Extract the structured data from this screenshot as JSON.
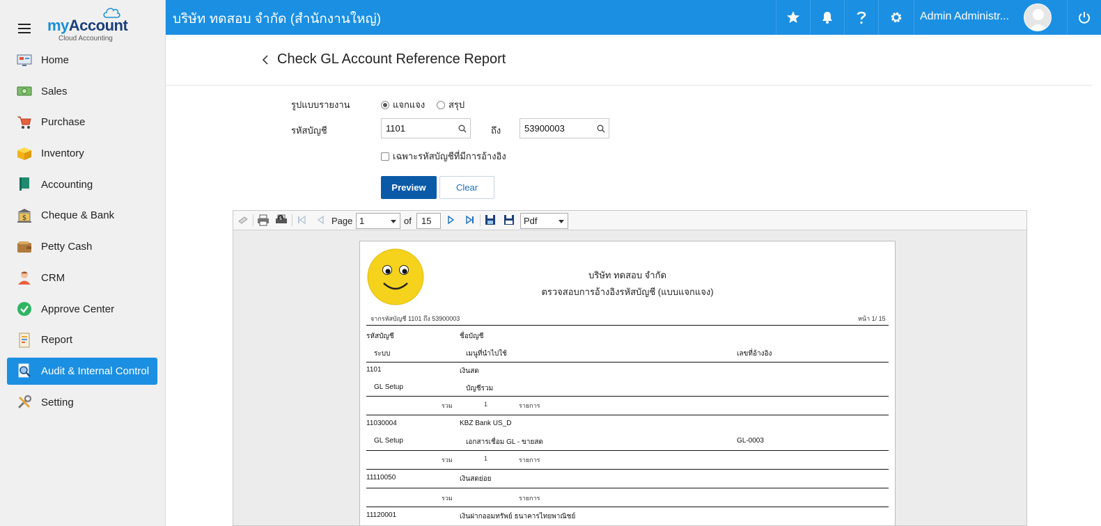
{
  "app": {
    "logo_word_my": "my",
    "logo_word_account": "Account",
    "logo_subtitle": "Cloud Accounting",
    "company": "บริษัท ทดสอบ จำกัด (สำนักงานใหญ่)",
    "user_name": "Admin Administr...",
    "brand_color": "#1b8fe2"
  },
  "sidebar": {
    "items": [
      {
        "label": "Home",
        "icon": "home-monitor-icon"
      },
      {
        "label": "Sales",
        "icon": "cash-icon"
      },
      {
        "label": "Purchase",
        "icon": "cart-icon"
      },
      {
        "label": "Inventory",
        "icon": "box-icon"
      },
      {
        "label": "Accounting",
        "icon": "ledger-book-icon"
      },
      {
        "label": "Cheque & Bank",
        "icon": "bank-icon"
      },
      {
        "label": "Petty Cash",
        "icon": "wallet-icon"
      },
      {
        "label": "CRM",
        "icon": "person-icon"
      },
      {
        "label": "Approve Center",
        "icon": "check-circle-icon"
      },
      {
        "label": "Report",
        "icon": "report-icon"
      },
      {
        "label": "Audit & Internal Control",
        "icon": "magnifier-doc-icon",
        "active": true
      },
      {
        "label": "Setting",
        "icon": "tools-icon"
      }
    ]
  },
  "page": {
    "title": "Check GL Account Reference Report"
  },
  "form": {
    "report_format_label": "รูปแบบรายงาน",
    "option_detail": "แจกแจง",
    "option_summary": "สรุป",
    "selected_option": "แจกแจง",
    "account_code_label": "รหัสบัญชี",
    "account_from": "1101",
    "to_label": "ถึง",
    "account_to": "53900003",
    "only_referenced_label": "เฉพาะรหัสบัญชีที่มีการอ้างอิง",
    "only_referenced_checked": false,
    "preview_label": "Preview",
    "clear_label": "Clear"
  },
  "viewer": {
    "page_label": "Page",
    "current_page": "1",
    "of_label": "of",
    "total_pages": "15",
    "export_format": "Pdf"
  },
  "report": {
    "company": "บริษัท ทดสอบ จำกัด",
    "title": "ตรวจสอบการอ้างอิงรหัสบัญชี (แบบแจกแจง)",
    "range": "จากรหัสบัญชี 1101 ถึง 53900003",
    "page_no": "หน้า 1/ 15",
    "col_account_code": "รหัสบัญชี",
    "col_account_name": "ชื่อบัญชี",
    "col_system": "ระบบ",
    "col_menu": "เมนูที่นำไปใช้",
    "col_ref": "เลขที่อ้างอิง",
    "total_label": "รวม",
    "items_label": "รายการ",
    "groups": [
      {
        "code": "1101",
        "name": "เงินสด",
        "system": "GL Setup",
        "menu": "บัญชีรวม",
        "ref": "",
        "count": "1"
      },
      {
        "code": "11030004",
        "name": "KBZ Bank US_D",
        "system": "GL Setup",
        "menu": "เอกสารเชื่อม GL - ขายสด",
        "ref": "GL-0003",
        "count": "1"
      },
      {
        "code": "11110050",
        "name": "เงินสดย่อย",
        "system": "",
        "menu": "",
        "ref": "",
        "count": ""
      },
      {
        "code": "11120001",
        "name": "เงินฝากออมทรัพย์ ธนาคารไทยพาณิชย์",
        "system": "",
        "menu": "",
        "ref": "",
        "count": ""
      }
    ]
  }
}
